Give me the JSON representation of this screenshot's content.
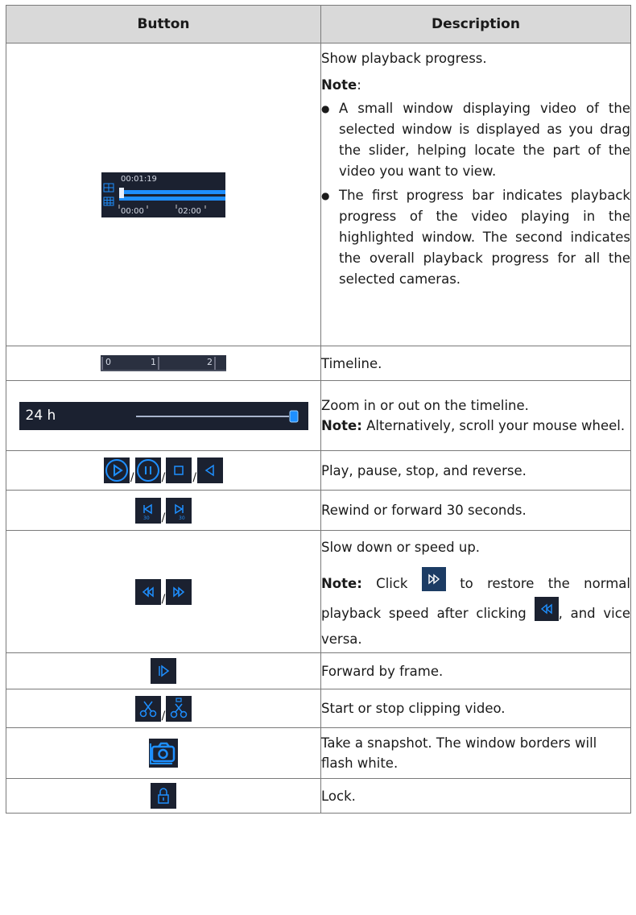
{
  "table": {
    "headers": {
      "button": "Button",
      "description": "Description"
    },
    "rows": [
      {
        "id": "progress",
        "widget": {
          "time_current": "00:01:19",
          "tick_start": "00:00",
          "tick_mid": "02:00"
        },
        "description": "Show playback progress.",
        "note_label": "Note",
        "note_suffix": ":",
        "notes": [
          "A small window displaying video of the selected window is displayed as you drag the slider, helping locate the part of the video you want to view.",
          "The first progress bar indicates playback progress of the video playing in the highlighted window. The second indicates the overall playback progress for all the selected cameras."
        ]
      },
      {
        "id": "timeline",
        "widget": {
          "tick_0": "0",
          "tick_1": "1",
          "tick_2": "2"
        },
        "description": "Timeline."
      },
      {
        "id": "zoom",
        "widget": {
          "label": "24 h"
        },
        "description": "Zoom in or out on the timeline.",
        "note_label": "Note:",
        "note_text": " Alternatively, scroll your mouse wheel."
      },
      {
        "id": "play",
        "separator": "/",
        "description": "Play, pause, stop, and reverse."
      },
      {
        "id": "skip",
        "separator": "/",
        "description": "Rewind or forward 30 seconds."
      },
      {
        "id": "speed",
        "separator": "/",
        "description": "Slow down or speed up.",
        "note_label": "Note:",
        "note_part1": " Click ",
        "note_part2": " to restore the normal playback speed after clicking ",
        "note_part3": ", and vice versa."
      },
      {
        "id": "frame",
        "description": "Forward by frame."
      },
      {
        "id": "clip",
        "separator": "/",
        "description": "Start or stop clipping video."
      },
      {
        "id": "snapshot",
        "description": "Take a snapshot. The window borders will flash white."
      },
      {
        "id": "lock",
        "description": "Lock."
      }
    ]
  },
  "colors": {
    "icon_bg": "#1b2130",
    "icon_blue": "#1e8fff",
    "header_bg": "#d9d9d9"
  }
}
